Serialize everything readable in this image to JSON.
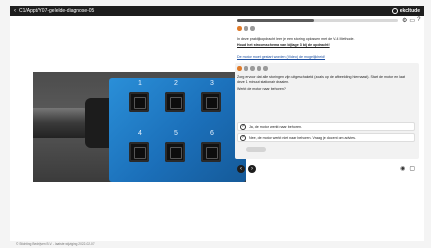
{
  "app": {
    "title": "C1/Appt/Y07-gelelde-diagnose-05",
    "brand": "ekcltude"
  },
  "icons": {
    "back": "chevron-left-icon",
    "brand_mark": "brand-logo-icon",
    "tool_1": "tool-icon",
    "tool_2": "screen-icon",
    "tool_3": "help-icon",
    "prev": "arrow-left-circle-icon",
    "next": "arrow-right-circle-icon",
    "view_1": "eye-icon",
    "view_2": "square-icon"
  },
  "progress": {
    "value_percent": 48
  },
  "content": {
    "intro_text": "In deze praktijkopdracht leer je een storing oplossen met de V-4 Methode.",
    "bold_link_text": "Houd het stroomschema van bijlage 3 bij de opdracht!",
    "extra_link_text": "De motor moet gestart worden (Video) de mogelijkheid!"
  },
  "card": {
    "line1": "Zorg ervoor dat alle storingen zijn uitgeschakeld (zoals op de afbeelding hiernaast). Start de motor en laat deze 1 minuut stationair draaien.",
    "line2": "Werkt de motor naar behoren?",
    "options": [
      {
        "label": "Ja, de motor werkt naar behoren."
      },
      {
        "label": "Nee, de motor werkt niet naar behoren. Vraag je docent om advies."
      }
    ]
  },
  "media": {
    "numbers": [
      "1",
      "2",
      "3",
      "4",
      "5",
      "6"
    ]
  },
  "footer": {
    "text": "© Stichting Bedrijven B.V. - laatste wijziging 2022-02-07"
  }
}
